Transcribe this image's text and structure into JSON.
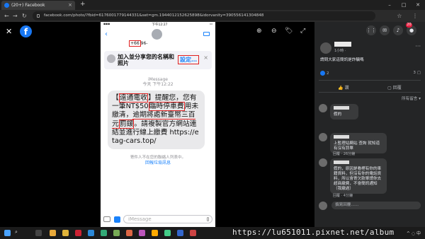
{
  "browser": {
    "tab_title": "(20+) Facebook",
    "new_tab": "+",
    "close_tab": "×",
    "url": "facebook.com/photo/?fbid=6176001779144331&set=gm.1944012152625898&idorvanity=390556141304848",
    "win_minimize": "–",
    "win_maximize": "□",
    "win_close": "✕"
  },
  "viewer": {
    "close": "✕",
    "fb_logo": "f",
    "zoom_in": "⊕",
    "zoom_out": "⊖",
    "tag": "🏷",
    "fullscreen": "⤢"
  },
  "phone": {
    "time": "下午12:27",
    "sender_number": "+66",
    "sender_rest": "96-",
    "share_prompt": "加入並分享您的名稱和照片",
    "share_button": "設定…",
    "share_close": "×",
    "timestamp_label": "iMessage",
    "timestamp": "今天 下午12:22",
    "msg_open": "【",
    "msg_brand": "遠通電收",
    "msg_close": "】",
    "msg_a": "提醒您，您有一筆NT$50",
    "msg_b": "臨時停車費",
    "msg_c": "用未繳清，",
    "msg_d": "逾期將處新臺幣三百元",
    "msg_e": "罰鍰",
    "msg_f": "。請複製官方網站連結並進行線上繳費 https://etag-cars.top/",
    "notice": "寄件人不在您的聯絡人列表中。",
    "report": "回報垃圾訊息",
    "input_placeholder": "iMessage"
  },
  "panel": {
    "notification_count": "20",
    "post_time": "1小時 · ",
    "post_text": "請問大家這簡訊是詐騙嗎",
    "like_count": "2",
    "comment_count": "3",
    "like_action": "讚",
    "comment_action": "回覆",
    "sort_label": "所有留言",
    "comments": [
      {
        "text": "假的",
        "meta": ""
      },
      {
        "text": "上監理站網站 查詢 就知道有沒有罰單",
        "meta": "回覆 · 26分鐘"
      },
      {
        "text": "假的，原因是看裡有你的車籍資料，但沒有你的電話資料，所以會寄欠款單請你去超商繳費，不會簡訊通知（我繳過）",
        "meta": "回覆 · 4分鐘"
      }
    ],
    "reply_placeholder": "撰寫回覆……"
  },
  "taskbar": {
    "search_icon": "⌕",
    "system_tray": "^ ◌ 中"
  },
  "watermark": "https://lu651011.pixnet.net/album"
}
